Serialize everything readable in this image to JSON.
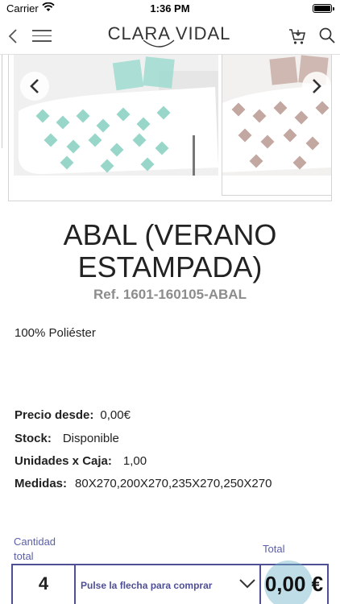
{
  "status_bar": {
    "carrier": "Carrier",
    "time": "1:36 PM"
  },
  "nav": {
    "logo_text": "CLARA VIDAL",
    "icons": [
      "back-chevron-icon",
      "menu-icon",
      "cart-icon",
      "search-icon"
    ]
  },
  "carousel": {
    "slide_count_visible": 2,
    "slides": [
      {
        "pattern_color": "#7fcbbf",
        "description_icon": "bedspread-image"
      },
      {
        "pattern_color": "#b99a92",
        "description_icon": "bedspread-image"
      }
    ]
  },
  "product": {
    "title_line1": "ABAL (VERANO",
    "title_line2": "ESTAMPADA)",
    "ref": "Ref. 1601-160105-ABAL",
    "composition": "100% Poliéster",
    "specs": {
      "price_label": "Precio desde:",
      "price_value": "0,00€",
      "stock_label": "Stock:",
      "stock_value": "Disponible",
      "units_label": "Unidades x Caja:",
      "units_value": "1,00",
      "sizes_label": "Medidas:",
      "sizes_value": "80X270,200X270,235X270,250X270"
    }
  },
  "buy": {
    "qty_label_line1": "Cantidad",
    "qty_label_line2": "total",
    "total_label": "Total",
    "qty_value": "4",
    "select_text": "Pulse la flecha para comprar",
    "total_value": "0,00 €"
  },
  "colors": {
    "accent": "#4f4f96",
    "label": "#5b5fa8",
    "ref_gray": "#8c8c8c"
  }
}
